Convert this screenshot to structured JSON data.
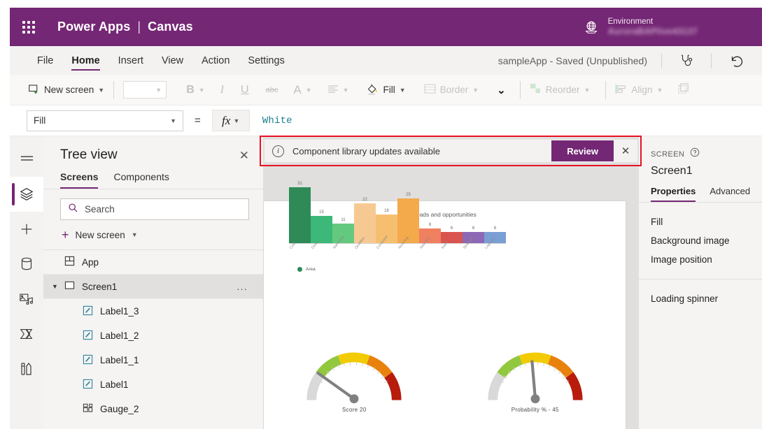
{
  "topbar": {
    "waffle_icon": "waffle-icon",
    "brand": "Power Apps",
    "separator": "|",
    "product": "Canvas",
    "environment_label": "Environment",
    "environment_name": "AuroraBAPlive43137",
    "globe_icon": "globe-icon",
    "accent": "#742774"
  },
  "menubar": {
    "items": [
      {
        "label": "File",
        "active": false
      },
      {
        "label": "Home",
        "active": true
      },
      {
        "label": "Insert",
        "active": false
      },
      {
        "label": "View",
        "active": false
      },
      {
        "label": "Action",
        "active": false
      },
      {
        "label": "Settings",
        "active": false
      }
    ],
    "app_status": "sampleApp - Saved (Unpublished)",
    "checker_icon": "stethoscope-icon",
    "undo_icon": "undo-icon"
  },
  "ribbon": {
    "new_screen": "New screen",
    "font_value": "",
    "bold": "B",
    "italic": "I",
    "underline": "U",
    "strikethrough": "abc",
    "font_color": "A",
    "align_icon": "text-align-icon",
    "fill": "Fill",
    "border": "Border",
    "more_chevron": "chevron-down-icon",
    "reorder": "Reorder",
    "align": "Align",
    "group_icon": "group-icon"
  },
  "formulabar": {
    "property": "Fill",
    "equals": "=",
    "fx": "fx",
    "formula": "White"
  },
  "rail": {
    "items": [
      {
        "name": "hamburger-menu-icon",
        "active": false
      },
      {
        "name": "tree-view-layers-icon",
        "active": true
      },
      {
        "name": "insert-plus-icon",
        "active": false
      },
      {
        "name": "data-database-icon",
        "active": false
      },
      {
        "name": "media-icon",
        "active": false
      },
      {
        "name": "power-automate-icon",
        "active": false
      },
      {
        "name": "variables-tools-icon",
        "active": false
      }
    ]
  },
  "treeview": {
    "title": "Tree view",
    "close_icon": "close-icon",
    "tabs": [
      {
        "label": "Screens",
        "active": true
      },
      {
        "label": "Components",
        "active": false
      }
    ],
    "search_placeholder": "Search",
    "search_icon": "search-icon",
    "new_screen": "New screen",
    "items": [
      {
        "label": "App",
        "icon": "app-icon",
        "level": 0,
        "selected": false,
        "expandable": false
      },
      {
        "label": "Screen1",
        "icon": "screen-icon",
        "level": 0,
        "selected": true,
        "expandable": true,
        "overflow": "..."
      },
      {
        "label": "Label1_3",
        "icon": "label-icon",
        "level": 1,
        "selected": false,
        "expandable": false
      },
      {
        "label": "Label1_2",
        "icon": "label-icon",
        "level": 1,
        "selected": false,
        "expandable": false
      },
      {
        "label": "Label1_1",
        "icon": "label-icon",
        "level": 1,
        "selected": false,
        "expandable": false
      },
      {
        "label": "Label1",
        "icon": "label-icon",
        "level": 1,
        "selected": false,
        "expandable": false
      },
      {
        "label": "Gauge_2",
        "icon": "gauge-icon",
        "level": 1,
        "selected": false,
        "expandable": false
      }
    ]
  },
  "banner": {
    "info_icon": "info-icon",
    "message": "Component library updates available",
    "review_label": "Review",
    "close_icon": "close-icon",
    "highlight_color": "#e81123",
    "button_color": "#742774"
  },
  "properties_panel": {
    "section_label": "SCREEN",
    "help_icon": "help-icon",
    "control_name": "Screen1",
    "tabs": [
      {
        "label": "Properties",
        "active": true
      },
      {
        "label": "Advanced",
        "active": false
      }
    ],
    "rows": [
      "Fill",
      "Background image",
      "Image position"
    ],
    "rows2": [
      "Loading spinner"
    ]
  },
  "chart_data": [
    {
      "type": "bar",
      "title": "Leads and opportunities",
      "categories": [
        "Cold",
        "Dead",
        "Marketing",
        "Qualified",
        "Contacted",
        "Nurturing",
        "New Test",
        "Intent",
        "Strategic",
        "Logistics"
      ],
      "values": [
        31,
        15,
        11,
        22,
        16,
        25,
        8,
        6,
        6,
        6
      ],
      "colors": [
        "#2e8b57",
        "#3cb878",
        "#63c97e",
        "#f7c992",
        "#f6bf70",
        "#f4a94b",
        "#ef8060",
        "#d9534f",
        "#8e68b5",
        "#7a9fd4"
      ],
      "legend": [
        {
          "name": "Area",
          "color": "#2e8b57"
        }
      ],
      "legend_position": "bottom-left",
      "ylim": [
        0,
        31
      ],
      "grid": false,
      "xlabel": "",
      "ylabel": ""
    },
    {
      "type": "gauge",
      "title": "Score",
      "caption": "Score   20",
      "value": 20,
      "min": 0,
      "max": 100,
      "bands": [
        {
          "color": "#d9d9d9",
          "from": 0,
          "to": 10
        },
        {
          "color": "#92c83e",
          "from": 10,
          "to": 38
        },
        {
          "color": "#f2cb05",
          "from": 38,
          "to": 60
        },
        {
          "color": "#e8820c",
          "from": 60,
          "to": 85
        },
        {
          "color": "#b71c0c",
          "from": 85,
          "to": 100
        }
      ]
    },
    {
      "type": "gauge",
      "title": "Probability %",
      "caption": "Probability % -  45",
      "value": 45,
      "min": 0,
      "max": 100,
      "bands": [
        {
          "color": "#d9d9d9",
          "from": 0,
          "to": 10
        },
        {
          "color": "#92c83e",
          "from": 10,
          "to": 38
        },
        {
          "color": "#f2cb05",
          "from": 38,
          "to": 60
        },
        {
          "color": "#e8820c",
          "from": 60,
          "to": 85
        },
        {
          "color": "#b71c0c",
          "from": 85,
          "to": 100
        }
      ]
    }
  ]
}
